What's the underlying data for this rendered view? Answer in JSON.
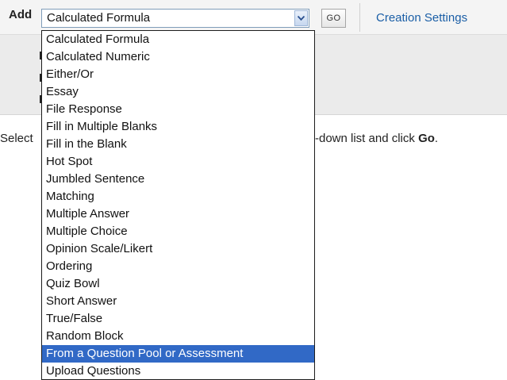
{
  "toolbar": {
    "add_label": "Add",
    "selected_type": "Calculated Formula",
    "go_label": "GO",
    "creation_settings_label": "Creation Settings"
  },
  "instructions": {
    "left": "Select",
    "right_prefix": "-down list and click ",
    "right_bold": "Go",
    "right_suffix": "."
  },
  "dropdown": {
    "highlighted_index": 18,
    "highlight_color": "#3169c6",
    "options": [
      "Calculated Formula",
      "Calculated Numeric",
      "Either/Or",
      "Essay",
      "File Response",
      "Fill in Multiple Blanks",
      "Fill in the Blank",
      "Hot Spot",
      "Jumbled Sentence",
      "Matching",
      "Multiple Answer",
      "Multiple Choice",
      "Opinion Scale/Likert",
      "Ordering",
      "Quiz Bowl",
      "Short Answer",
      "True/False",
      "Random Block",
      "From a Question Pool or Assessment",
      "Upload Questions"
    ]
  }
}
